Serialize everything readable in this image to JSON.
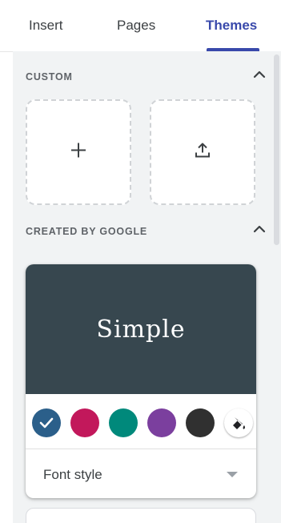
{
  "tabs": [
    {
      "label": "Insert",
      "active": false
    },
    {
      "label": "Pages",
      "active": false
    },
    {
      "label": "Themes",
      "active": true
    }
  ],
  "sections": {
    "custom": {
      "title": "CUSTOM",
      "collapse_icon": "chevron-up-icon"
    },
    "google": {
      "title": "CREATED BY GOOGLE",
      "collapse_icon": "chevron-up-icon"
    }
  },
  "custom_tiles": [
    {
      "icon": "add-icon"
    },
    {
      "icon": "upload-icon"
    }
  ],
  "theme": {
    "name": "Simple",
    "preview_color": "#37474f",
    "swatches": [
      {
        "color": "#2b5f8a",
        "selected": true
      },
      {
        "color": "#c2185b",
        "selected": false
      },
      {
        "color": "#00897b",
        "selected": false
      },
      {
        "color": "#7b3f9e",
        "selected": false
      },
      {
        "color": "#303030",
        "selected": false
      }
    ],
    "custom_color_icon": "paint-bucket-icon",
    "font_style_label": "Font style"
  },
  "colors": {
    "accent": "#3949ab",
    "panel_bg": "#f1f3f4"
  }
}
